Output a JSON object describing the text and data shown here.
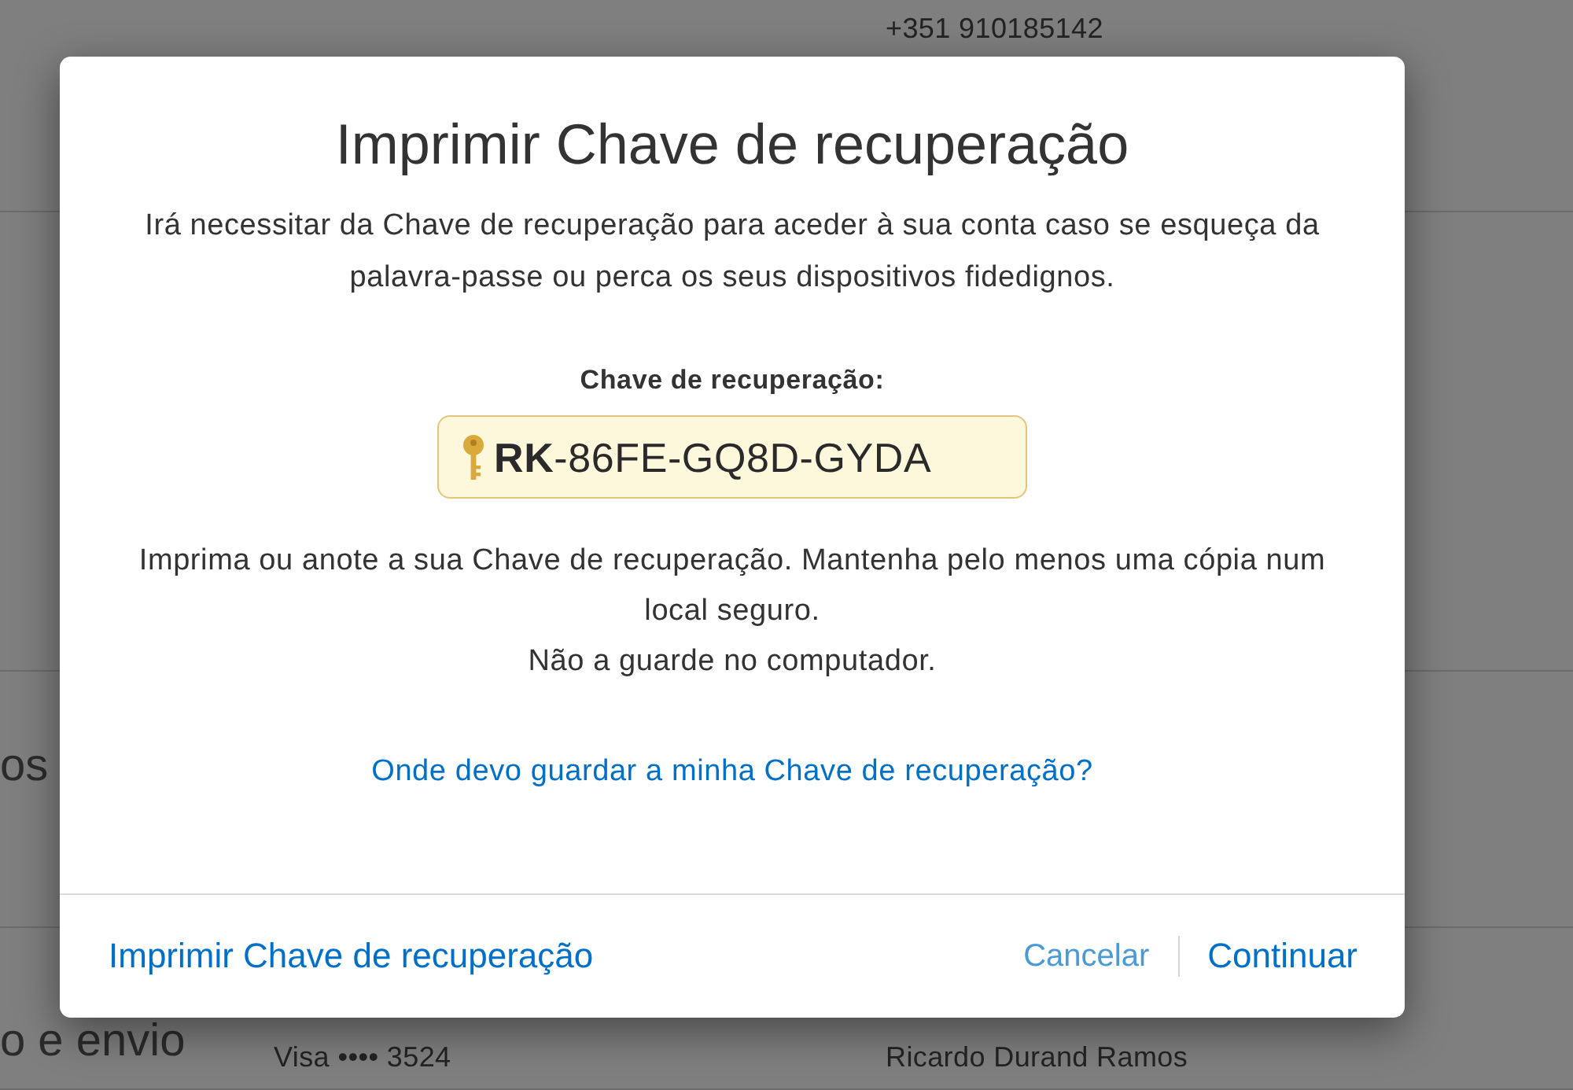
{
  "background_page": {
    "phone": "+351 910185142",
    "sections": [
      {
        "heading": "os"
      },
      {
        "heading": "o e envio",
        "payment_card": "Visa •••• 3524",
        "contact_name": "Ricardo Durand Ramos"
      }
    ]
  },
  "dialog": {
    "title": "Imprimir Chave de recuperação",
    "description": "Irá necessitar da Chave de recuperação para aceder à sua conta caso se esqueça da palavra-passe ou perca os seus dispositivos fidedignos.",
    "key_label": "Chave de recuperação:",
    "recovery_key": "**RK**-86FE-GQ8D-GYDA",
    "instructions": [
      "Imprima ou anote a sua Chave de recuperação. Mantenha pelo menos uma cópia num local seguro.",
      "Não a guarde no computador."
    ],
    "help_link": "Onde devo guardar a minha Chave de recuperação?",
    "footer": {
      "print_link": "Imprimir Chave de recuperação",
      "buttons": [
        {
          "label": "Cancelar",
          "kind": "secondary"
        },
        {
          "label": "Continuar",
          "kind": "primary"
        }
      ]
    }
  }
}
